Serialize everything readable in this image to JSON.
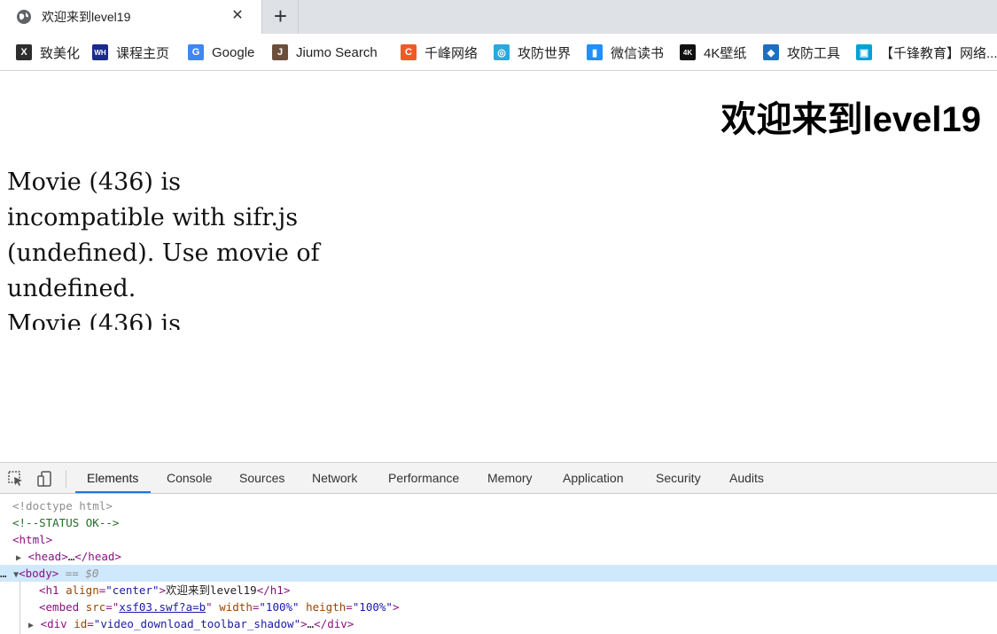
{
  "tab": {
    "title": "欢迎来到level19",
    "close": "✕",
    "new_tab": "+"
  },
  "bookmarks": [
    {
      "label": "致美化",
      "icon": "x-logo-icon",
      "glyph": "X",
      "color": "#2d2d2d"
    },
    {
      "label": "课程主页",
      "icon": "wh-logo-icon",
      "glyph": "WH",
      "color": "#1b2a8c"
    },
    {
      "label": "Google",
      "icon": "google-icon",
      "glyph": "G",
      "color": "#4285f4"
    },
    {
      "label": "Jiumo Search",
      "icon": "jiumo-icon",
      "glyph": "J",
      "color": "#6b4f3a"
    },
    {
      "label": "千峰网络",
      "icon": "c-logo-icon",
      "glyph": "C",
      "color": "#f05a28"
    },
    {
      "label": "攻防世界",
      "icon": "globe-logo-icon",
      "glyph": "◎",
      "color": "#2aa8e0"
    },
    {
      "label": "微信读书",
      "icon": "wechat-read-icon",
      "glyph": "▮",
      "color": "#1e90ff"
    },
    {
      "label": "4K壁纸",
      "icon": "4k-icon",
      "glyph": "4K",
      "color": "#111111"
    },
    {
      "label": "攻防工具",
      "icon": "shield-tool-icon",
      "glyph": "◆",
      "color": "#1d6fc0"
    },
    {
      "label": "【千锋教育】网络...",
      "icon": "bilibili-icon",
      "glyph": "▣",
      "color": "#00a1d6"
    }
  ],
  "page": {
    "heading": "欢迎来到level19",
    "embed_text_1": "Movie (436) is incompatible with sifr.js (undefined). Use movie of undefined.",
    "embed_text_2": "Movie (436) is"
  },
  "devtools": {
    "tabs": [
      "Elements",
      "Console",
      "Sources",
      "Network",
      "Performance",
      "Memory",
      "Application",
      "Security",
      "Audits"
    ],
    "active_tab": "Elements",
    "dom": {
      "doctype": "<!doctype html>",
      "comment": "<!--STATUS OK-->",
      "html_open": "<html>",
      "head_tag": "<head>",
      "head_ellipsis": "…",
      "head_close": "</head>",
      "body_tag": "<body>",
      "body_marker": "== $0",
      "h1_open": "<h1",
      "h1_attr": "align",
      "h1_val": "\"center\"",
      "h1_text": "欢迎来到level19",
      "h1_close": "</h1>",
      "embed_open": "<embed",
      "embed_src_attr": "src",
      "embed_src_val": "xsf03.swf?a=b",
      "embed_width_attr": "width",
      "embed_width_val": "\"100%\"",
      "embed_heigth_attr": "heigth",
      "embed_heigth_val": "\"100%\"",
      "div_open": "<div",
      "div_id_attr": "id",
      "div_id_val": "\"video_download_toolbar_shadow\"",
      "div_ellipsis": "…",
      "div_close": "</div>"
    }
  }
}
